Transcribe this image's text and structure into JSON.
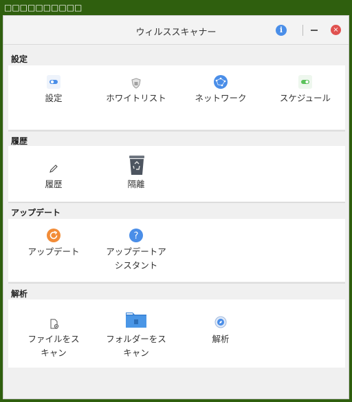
{
  "outer_window": {
    "title": "□□□□□□□□□□"
  },
  "header": {
    "title": "ウィルススキャナー",
    "info_label": "i",
    "close_label": "×"
  },
  "sections": {
    "settings": {
      "title": "設定",
      "items": [
        {
          "label": "設定",
          "icon": "toggle-icon"
        },
        {
          "label": "ホワイトリスト",
          "icon": "shield-icon"
        },
        {
          "label": "ネットワーク",
          "icon": "network-globe-icon"
        },
        {
          "label": "スケジュール",
          "icon": "schedule-toggle-icon"
        }
      ]
    },
    "history": {
      "title": "履歴",
      "items": [
        {
          "label": "履歴",
          "icon": "pencil-icon"
        },
        {
          "label": "隔離",
          "icon": "recycle-bin-icon"
        }
      ]
    },
    "update": {
      "title": "アップデート",
      "items": [
        {
          "label": "アップデート",
          "icon": "refresh-icon"
        },
        {
          "label_line1": "アップデートア",
          "label_line2": "シスタント",
          "icon": "question-icon"
        }
      ]
    },
    "analysis": {
      "title": "解析",
      "items": [
        {
          "label_line1": "ファイルをス",
          "label_line2": "キャン",
          "icon": "file-scan-icon"
        },
        {
          "label_line1": "フォルダーをス",
          "label_line2": "キャン",
          "icon": "folder-icon"
        },
        {
          "label": "解析",
          "icon": "compass-icon"
        }
      ]
    }
  },
  "colors": {
    "outer_frame": "#2f5f0e",
    "accent_blue": "#4a8ee8",
    "orange": "#f28c38",
    "green_toggle": "#5cc25c",
    "close_red": "#e0514f"
  }
}
